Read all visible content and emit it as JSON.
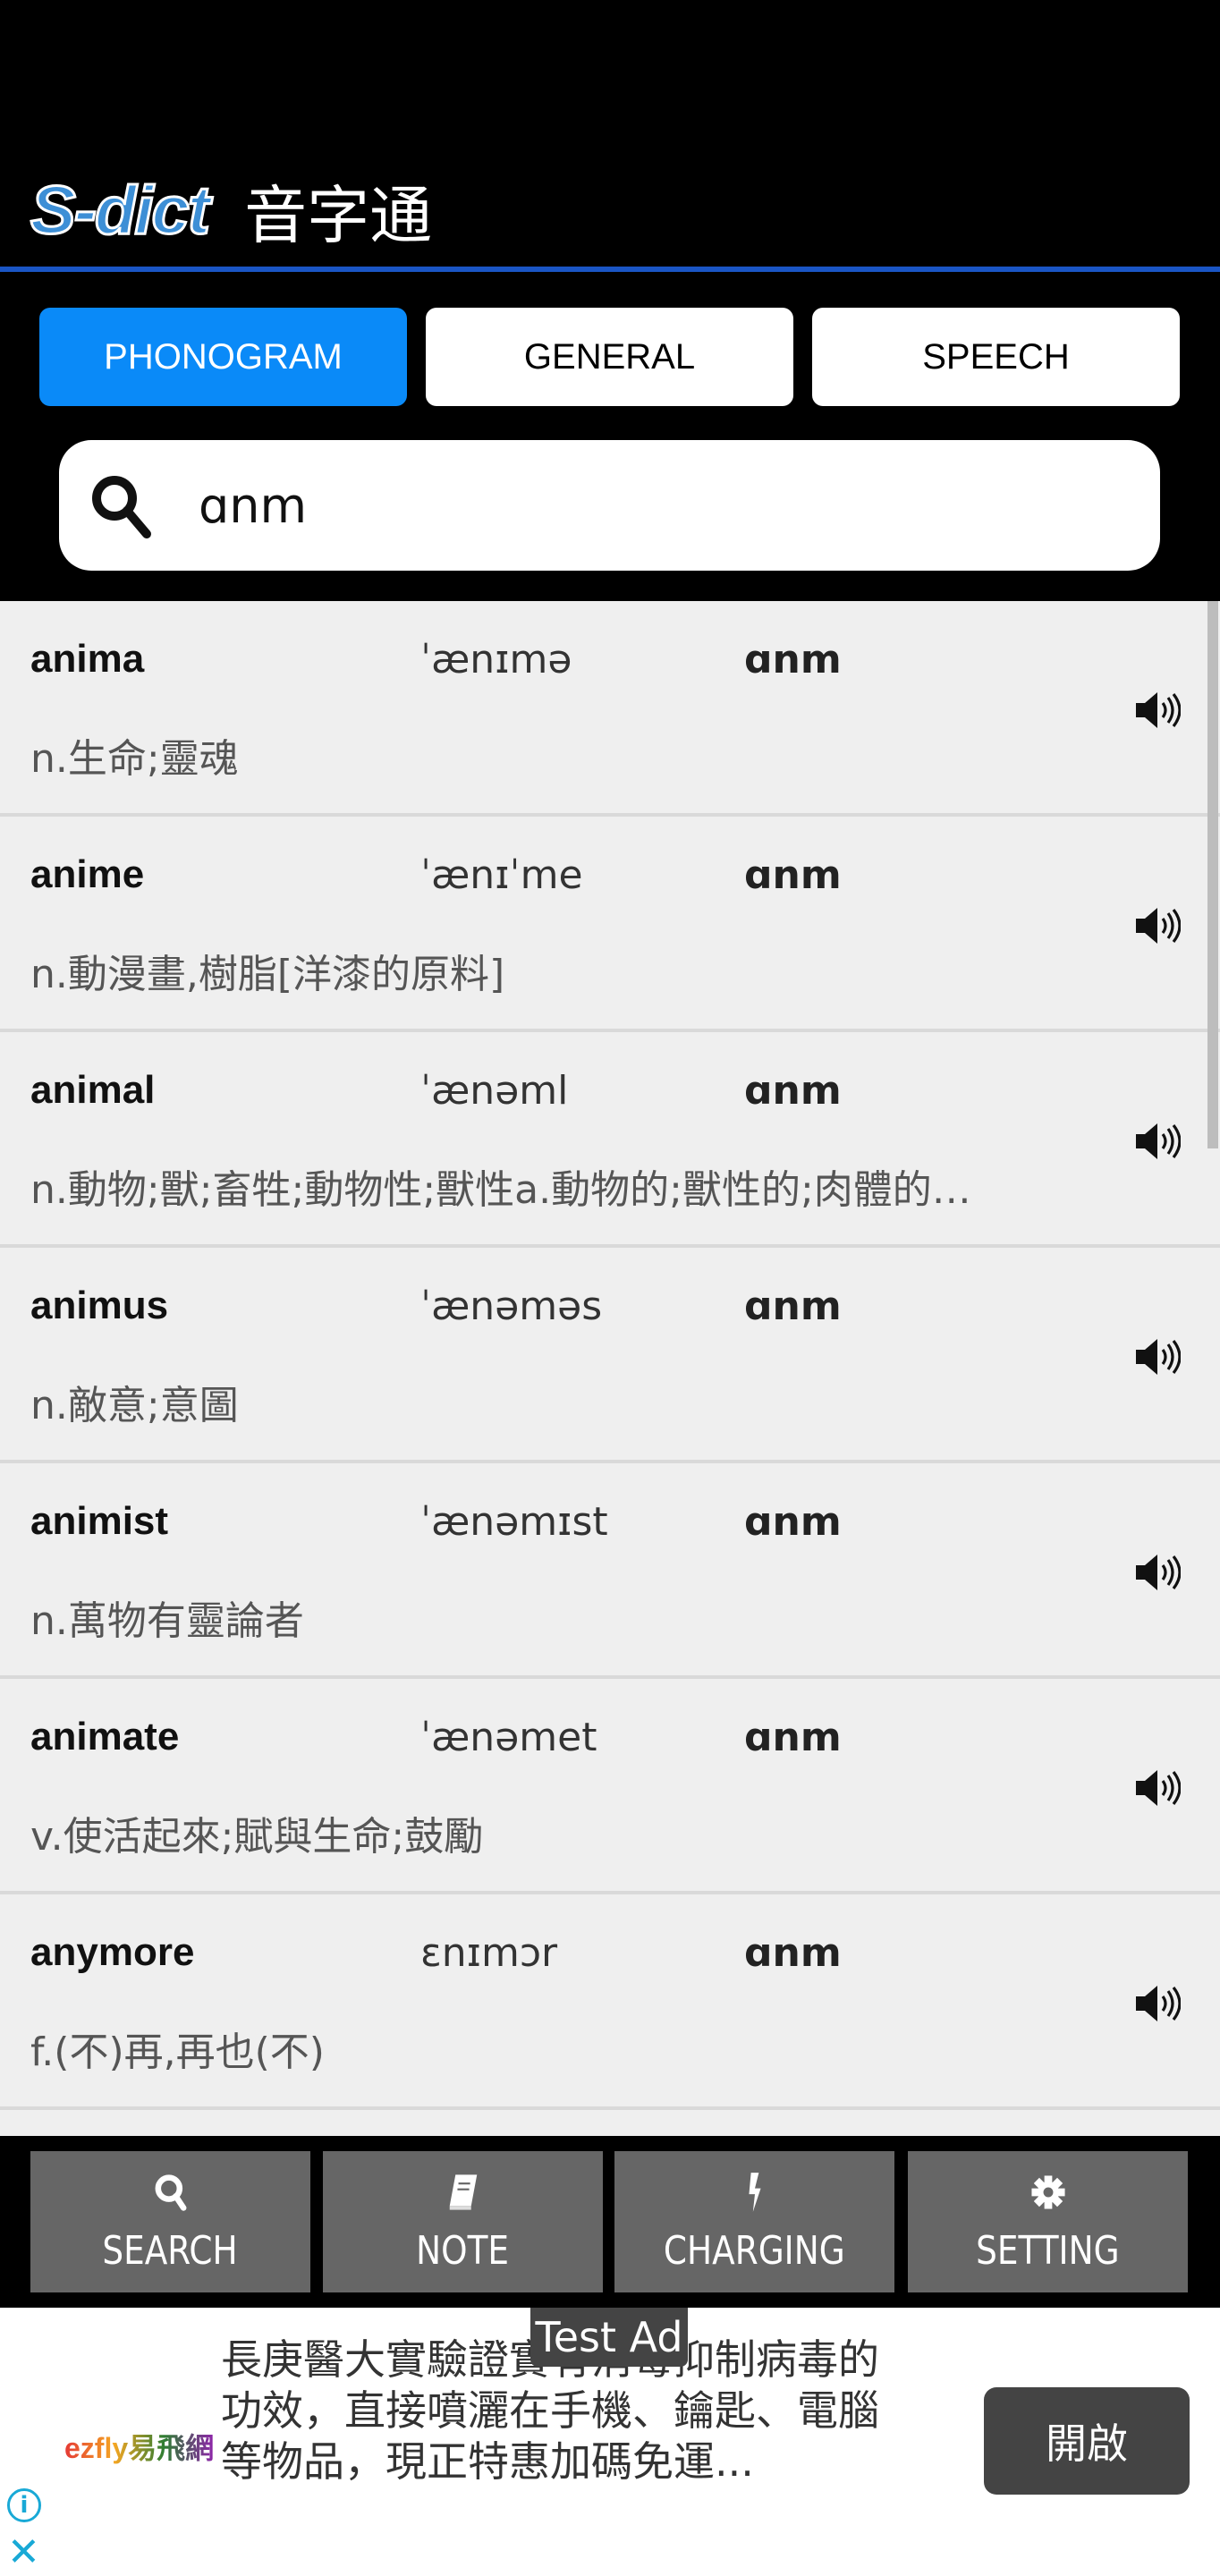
{
  "header": {
    "logo_mark": "S-dict",
    "title": "音字通"
  },
  "tabs": [
    {
      "label": "PHONOGRAM",
      "active": true
    },
    {
      "label": "GENERAL",
      "active": false
    },
    {
      "label": "SPEECH",
      "active": false
    }
  ],
  "search": {
    "value": "ɑnm",
    "icon": "search-icon"
  },
  "results": [
    {
      "word": "anima",
      "phonetic": "ˈænɪmə",
      "key": "ɑnm",
      "definition": "n.生命;靈魂"
    },
    {
      "word": "anime",
      "phonetic": "ˈænɪˈme",
      "key": "ɑnm",
      "definition": "n.動漫畫,樹脂[洋漆的原料]"
    },
    {
      "word": "animal",
      "phonetic": "ˈænəml",
      "key": "ɑnm",
      "definition": "n.動物;獸;畜牲;動物性;獸性a.動物的;獸性的;肉體的…"
    },
    {
      "word": "animus",
      "phonetic": "ˈænəməs",
      "key": "ɑnm",
      "definition": "n.敵意;意圖"
    },
    {
      "word": "animist",
      "phonetic": "ˈænəmɪst",
      "key": "ɑnm",
      "definition": "n.萬物有靈論者"
    },
    {
      "word": "animate",
      "phonetic": "ˈænəmet",
      "key": "ɑnm",
      "definition": "v.使活起來;賦與生命;鼓勵"
    },
    {
      "word": "anymore",
      "phonetic": "ɛnɪmɔr",
      "key": "ɑnm",
      "definition": "f.(不)再,再也(不)"
    }
  ],
  "nav": [
    {
      "label": "SEARCH",
      "icon": "search-icon"
    },
    {
      "label": "NOTE",
      "icon": "book-icon"
    },
    {
      "label": "CHARGING",
      "icon": "bolt-icon"
    },
    {
      "label": "SETTING",
      "icon": "gear-icon"
    }
  ],
  "ad": {
    "label": "Test Ad",
    "logo": "ezfly易飛網",
    "text": "長庚醫大實驗證實有消毒抑制病毒的功效，直接噴灑在手機、鑰匙、電腦等物品，現正特惠加碼免運...",
    "button": "開啟",
    "info_icon": "info-icon",
    "close_icon": "close-icon"
  },
  "colors": {
    "accent": "#0a8af8",
    "header_line": "#1a55c4",
    "nav_button": "#666666"
  }
}
